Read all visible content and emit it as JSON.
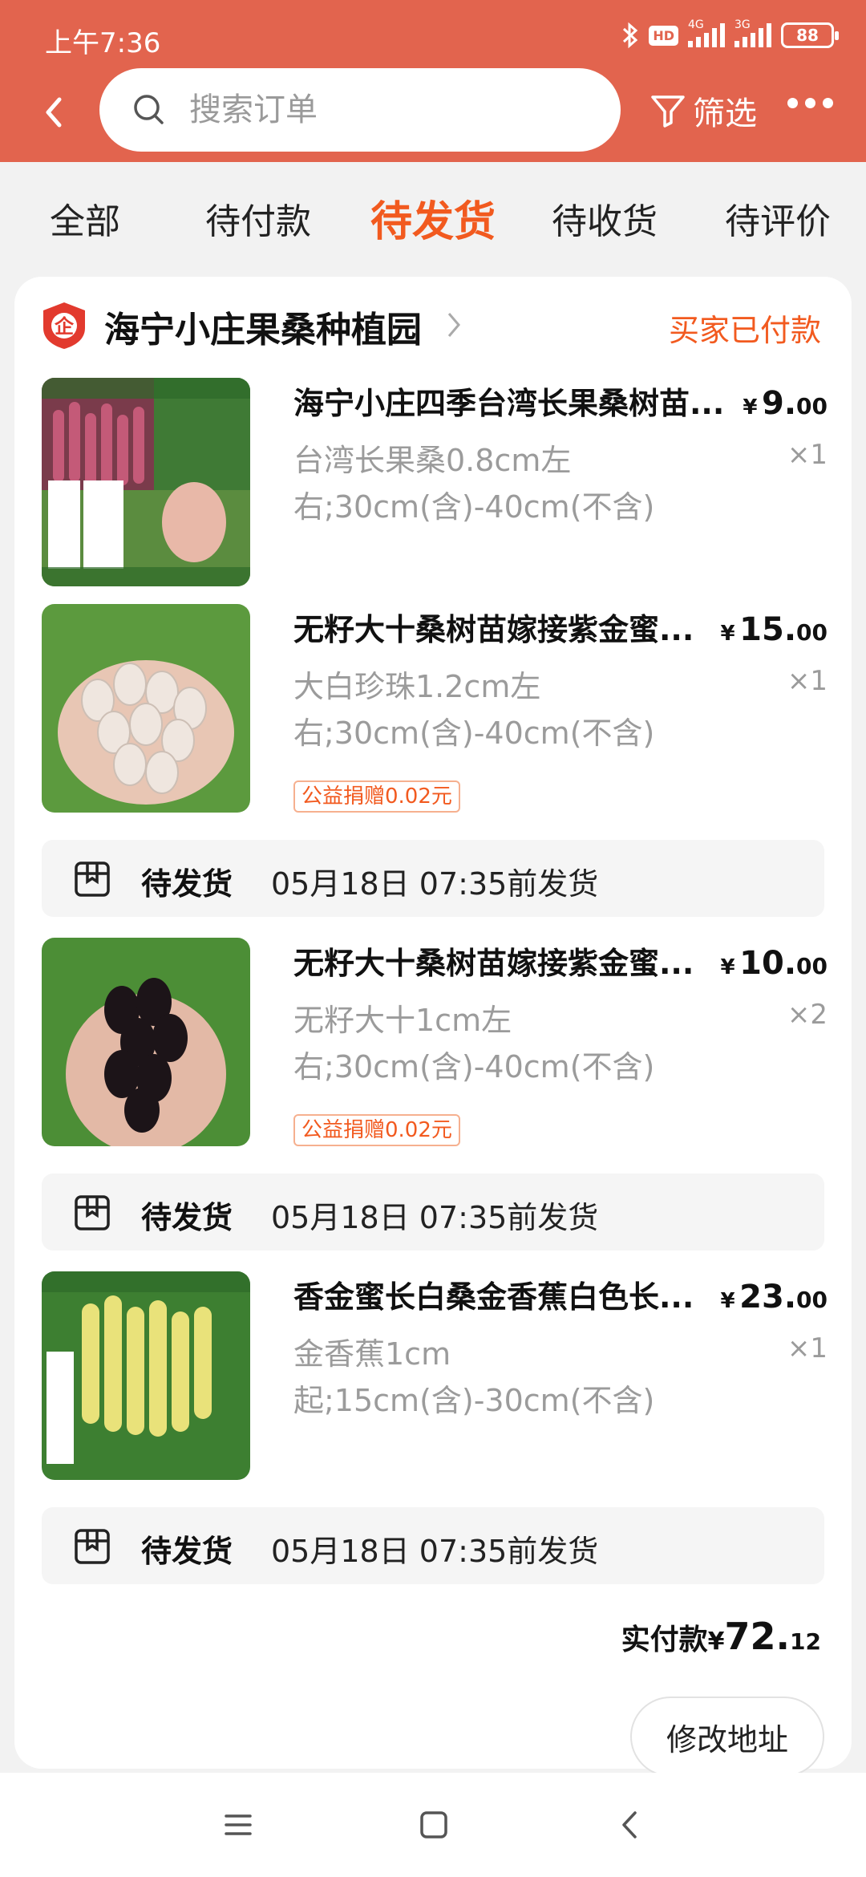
{
  "status_bar": {
    "time": "上午7:36",
    "hd": "HD",
    "net1": "4G",
    "net2": "3G",
    "battery": "88"
  },
  "header": {
    "search_placeholder": "搜索订单",
    "filter_label": "筛选"
  },
  "tabs": [
    {
      "label": "全部"
    },
    {
      "label": "待付款"
    },
    {
      "label": "待发货",
      "active": true
    },
    {
      "label": "待收货"
    },
    {
      "label": "待评价"
    }
  ],
  "order": {
    "shop_badge": "企",
    "shop_name": "海宁小庄果桑种植园",
    "status": "买家已付款",
    "items": [
      {
        "title": "海宁小庄四季台湾长果桑树苗...",
        "price_cur": "¥",
        "price_int": "9.",
        "price_dec": "00",
        "sku": "台湾长果桑0.8cm左右;30cm(含)-40cm(不含)",
        "qty": "×1"
      },
      {
        "title": "无籽大十桑树苗嫁接紫金蜜...",
        "price_cur": "¥",
        "price_int": "15.",
        "price_dec": "00",
        "sku": "大白珍珠1.2cm左右;30cm(含)-40cm(不含)",
        "qty": "×1",
        "charity": "公益捐赠0.02元"
      },
      {
        "title": "无籽大十桑树苗嫁接紫金蜜...",
        "price_cur": "¥",
        "price_int": "10.",
        "price_dec": "00",
        "sku": "无籽大十1cm左右;30cm(含)-40cm(不含)",
        "qty": "×2",
        "charity": "公益捐赠0.02元"
      },
      {
        "title": "香金蜜长白桑金香蕉白色长...",
        "price_cur": "¥",
        "price_int": "23.",
        "price_dec": "00",
        "sku": "金香蕉1cm起;15cm(含)-30cm(不含)",
        "qty": "×1"
      }
    ],
    "shipping": [
      {
        "status": "待发货",
        "deadline": "05月18日 07:35前发货"
      },
      {
        "status": "待发货",
        "deadline": "05月18日 07:35前发货"
      },
      {
        "status": "待发货",
        "deadline": "05月18日 07:35前发货"
      }
    ],
    "total_label": "实付款",
    "total_cur": "¥",
    "total_int": "72.",
    "total_dec": "12",
    "modify_address": "修改地址"
  },
  "colors": {
    "header": "#e2644e",
    "accent": "#f25a1f"
  }
}
